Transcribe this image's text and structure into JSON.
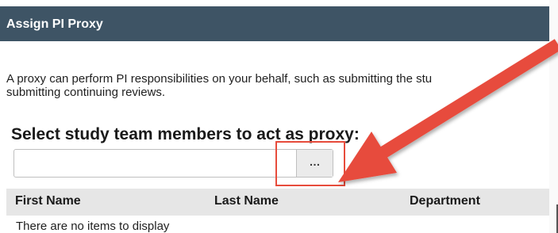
{
  "dialog": {
    "title": "Assign PI Proxy",
    "description_line1": "A proxy can perform PI responsibilities on your behalf, such as submitting the stu",
    "description_line2": "submitting continuing reviews.",
    "section_heading": "Select study team members to act as proxy:",
    "search": {
      "value": "",
      "placeholder": ""
    },
    "browse_button_label": "…",
    "table": {
      "columns": [
        "First Name",
        "Last Name",
        "Department"
      ],
      "empty_message": "There are no items to display"
    }
  },
  "colors": {
    "title_bar": "#3e5465",
    "annotation_red": "#e74c3c",
    "table_header_bg": "#e6e6e6"
  }
}
